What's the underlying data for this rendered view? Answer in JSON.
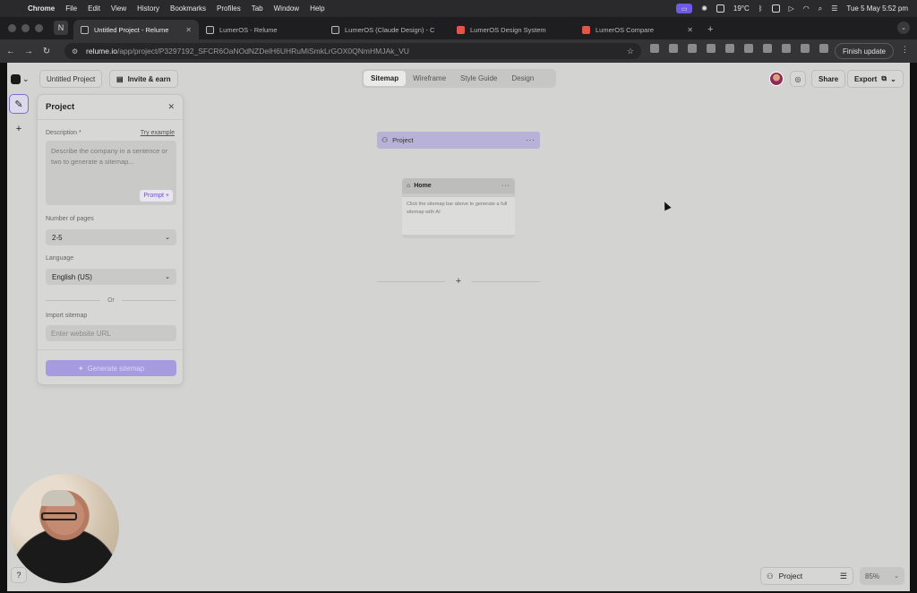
{
  "menubar": {
    "items": [
      "Chrome",
      "File",
      "Edit",
      "View",
      "History",
      "Bookmarks",
      "Profiles",
      "Tab",
      "Window",
      "Help"
    ],
    "temperature": "19°C",
    "clock": "Tue 5 May  5:52 pm"
  },
  "browser": {
    "tabs": [
      {
        "title": "Untitled Project - Relume",
        "active": true
      },
      {
        "title": "LumerOS - Relume"
      },
      {
        "title": "LumerOS (Claude Design) - C"
      },
      {
        "title": "LumerOS Design System"
      },
      {
        "title": "LumerOS Compare"
      }
    ],
    "url_host": "relume.io",
    "url_path": "/app/project/P3297192_SFCR6OaNOdNZDelH6UHRuMiSmkLrGOX0QNmHMJAk_VU",
    "finish_update": "Finish update"
  },
  "app": {
    "project_name": "Untitled Project",
    "invite": "Invite & earn",
    "view_tabs": [
      "Sitemap",
      "Wireframe",
      "Style Guide",
      "Design"
    ],
    "share": "Share",
    "export": "Export"
  },
  "panel": {
    "title": "Project",
    "description_label": "Description *",
    "try_example": "Try example",
    "description_placeholder": "Describe the company in a sentence or two to generate a sitemap...",
    "prompt_tag": "Prompt +",
    "pages_label": "Number of pages",
    "pages_value": "2-5",
    "language_label": "Language",
    "language_value": "English (US)",
    "or": "Or",
    "import_label": "Import sitemap",
    "url_placeholder": "Enter website URL",
    "generate": "Generate sitemap"
  },
  "canvas": {
    "project_node": "Project",
    "home_title": "Home",
    "home_body": "Click the sitemap bar above to generate a full sitemap with AI"
  },
  "bottom": {
    "help": "?",
    "project_selector": "Project",
    "zoom": "85%"
  },
  "colors": {
    "accent": "#7c6cd8",
    "project_node": "#b8b2d8",
    "generate_button": "#a79be0",
    "canvas": "#d3d3d2"
  }
}
